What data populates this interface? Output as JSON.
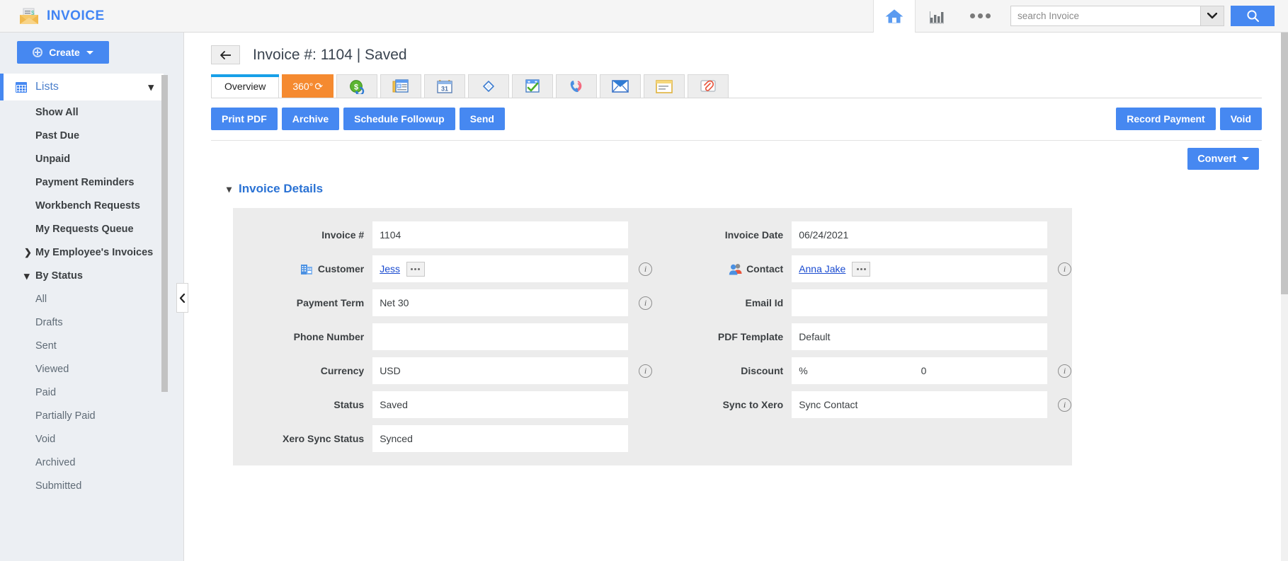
{
  "app": {
    "brand": "INVOICE",
    "brand_color": "#4285f4",
    "logo_icon": "envelope-invoice-icon"
  },
  "topbar": {
    "home_icon": "home-icon",
    "reports_icon": "bar-chart-icon",
    "more_icon": "ellipsis-icon",
    "search": {
      "placeholder": "search Invoice",
      "value": "",
      "dropdown_icon": "chevron-down-icon",
      "button_icon": "search-icon"
    }
  },
  "sidebar": {
    "create_label": "Create",
    "create_icon": "plus-circle-icon",
    "lists": {
      "label": "Lists",
      "icon": "grid-icon",
      "chevron": "chevron-down-icon"
    },
    "items": [
      {
        "label": "Show All",
        "level": 1,
        "twisty": ""
      },
      {
        "label": "Past Due",
        "level": 1,
        "twisty": ""
      },
      {
        "label": "Unpaid",
        "level": 1,
        "twisty": ""
      },
      {
        "label": "Payment Reminders",
        "level": 1,
        "twisty": ""
      },
      {
        "label": "Workbench Requests",
        "level": 1,
        "twisty": ""
      },
      {
        "label": "My Requests Queue",
        "level": 1,
        "twisty": ""
      },
      {
        "label": "My Employee's Invoices",
        "level": 1,
        "twisty": "❯"
      },
      {
        "label": "By Status",
        "level": 1,
        "twisty": "⌄"
      },
      {
        "label": "All",
        "level": 2,
        "twisty": ""
      },
      {
        "label": "Drafts",
        "level": 2,
        "twisty": ""
      },
      {
        "label": "Sent",
        "level": 2,
        "twisty": ""
      },
      {
        "label": "Viewed",
        "level": 2,
        "twisty": ""
      },
      {
        "label": "Paid",
        "level": 2,
        "twisty": ""
      },
      {
        "label": "Partially Paid",
        "level": 2,
        "twisty": ""
      },
      {
        "label": "Void",
        "level": 2,
        "twisty": ""
      },
      {
        "label": "Archived",
        "level": 2,
        "twisty": ""
      },
      {
        "label": "Submitted",
        "level": 2,
        "twisty": ""
      }
    ],
    "collapse_icon": "chevron-left-icon"
  },
  "main": {
    "back_icon": "arrow-left-icon",
    "title": "Invoice #: 1104 | Saved",
    "tabs": [
      {
        "label": "Overview",
        "type": "text",
        "state": "active",
        "icon": ""
      },
      {
        "label": "360°",
        "type": "text",
        "state": "orange",
        "icon": "refresh-360-icon"
      },
      {
        "label": "",
        "type": "icon",
        "state": "normal",
        "icon": "money-dollar-icon"
      },
      {
        "label": "",
        "type": "icon",
        "state": "normal",
        "icon": "news-article-icon"
      },
      {
        "label": "",
        "type": "icon",
        "state": "normal",
        "icon": "calendar-icon"
      },
      {
        "label": "",
        "type": "icon",
        "state": "normal",
        "icon": "pin-icon"
      },
      {
        "label": "",
        "type": "icon",
        "state": "normal",
        "icon": "task-checklist-icon"
      },
      {
        "label": "",
        "type": "icon",
        "state": "normal",
        "icon": "phone-call-icon"
      },
      {
        "label": "",
        "type": "icon",
        "state": "normal",
        "icon": "email-envelope-icon"
      },
      {
        "label": "",
        "type": "icon",
        "state": "normal",
        "icon": "note-icon"
      },
      {
        "label": "",
        "type": "icon",
        "state": "normal",
        "icon": "attachment-icon"
      }
    ],
    "actions_left": [
      {
        "label": "Print PDF"
      },
      {
        "label": "Archive"
      },
      {
        "label": "Schedule Followup"
      },
      {
        "label": "Send"
      }
    ],
    "actions_right": [
      {
        "label": "Record Payment"
      },
      {
        "label": "Void"
      }
    ],
    "convert": {
      "label": "Convert",
      "caret": "caret-down-icon"
    },
    "section": {
      "title": "Invoice Details",
      "chevron": "chevron-down-icon"
    },
    "fields_left": [
      {
        "label": "Invoice #",
        "value": "1104",
        "icon": "",
        "info": false,
        "type": "text"
      },
      {
        "label": "Customer",
        "value": "Jess",
        "icon": "building-icon",
        "info": true,
        "type": "lookup"
      },
      {
        "label": "Payment Term",
        "value": "Net 30",
        "icon": "",
        "info": true,
        "type": "text"
      },
      {
        "label": "Phone Number",
        "value": "",
        "icon": "",
        "info": false,
        "type": "text"
      },
      {
        "label": "Currency",
        "value": "USD",
        "icon": "",
        "info": true,
        "type": "text"
      },
      {
        "label": "Status",
        "value": "Saved",
        "icon": "",
        "info": false,
        "type": "text"
      },
      {
        "label": "Xero Sync Status",
        "value": "Synced",
        "icon": "",
        "info": false,
        "type": "text"
      }
    ],
    "fields_right": [
      {
        "label": "Invoice Date",
        "value": "06/24/2021",
        "icon": "",
        "info": false,
        "type": "text"
      },
      {
        "label": "Contact",
        "value": "Anna Jake",
        "icon": "people-icon",
        "info": true,
        "type": "lookup"
      },
      {
        "label": "Email Id",
        "value": "",
        "icon": "",
        "info": false,
        "type": "text"
      },
      {
        "label": "PDF Template",
        "value": "Default",
        "icon": "",
        "info": false,
        "type": "text"
      },
      {
        "label": "Discount",
        "value": "0",
        "prefix": "%",
        "icon": "",
        "info": true,
        "type": "discount"
      },
      {
        "label": "Sync to Xero",
        "value": "Sync Contact",
        "icon": "",
        "info": true,
        "type": "text"
      }
    ]
  },
  "colors": {
    "accent_blue": "#4688f1",
    "tab_orange": "#f58a30",
    "active_tab_bar": "#18a0e8",
    "link_blue": "#1a4bd0",
    "sidebar_bg": "#eceff3",
    "panel_bg": "#ececec"
  }
}
